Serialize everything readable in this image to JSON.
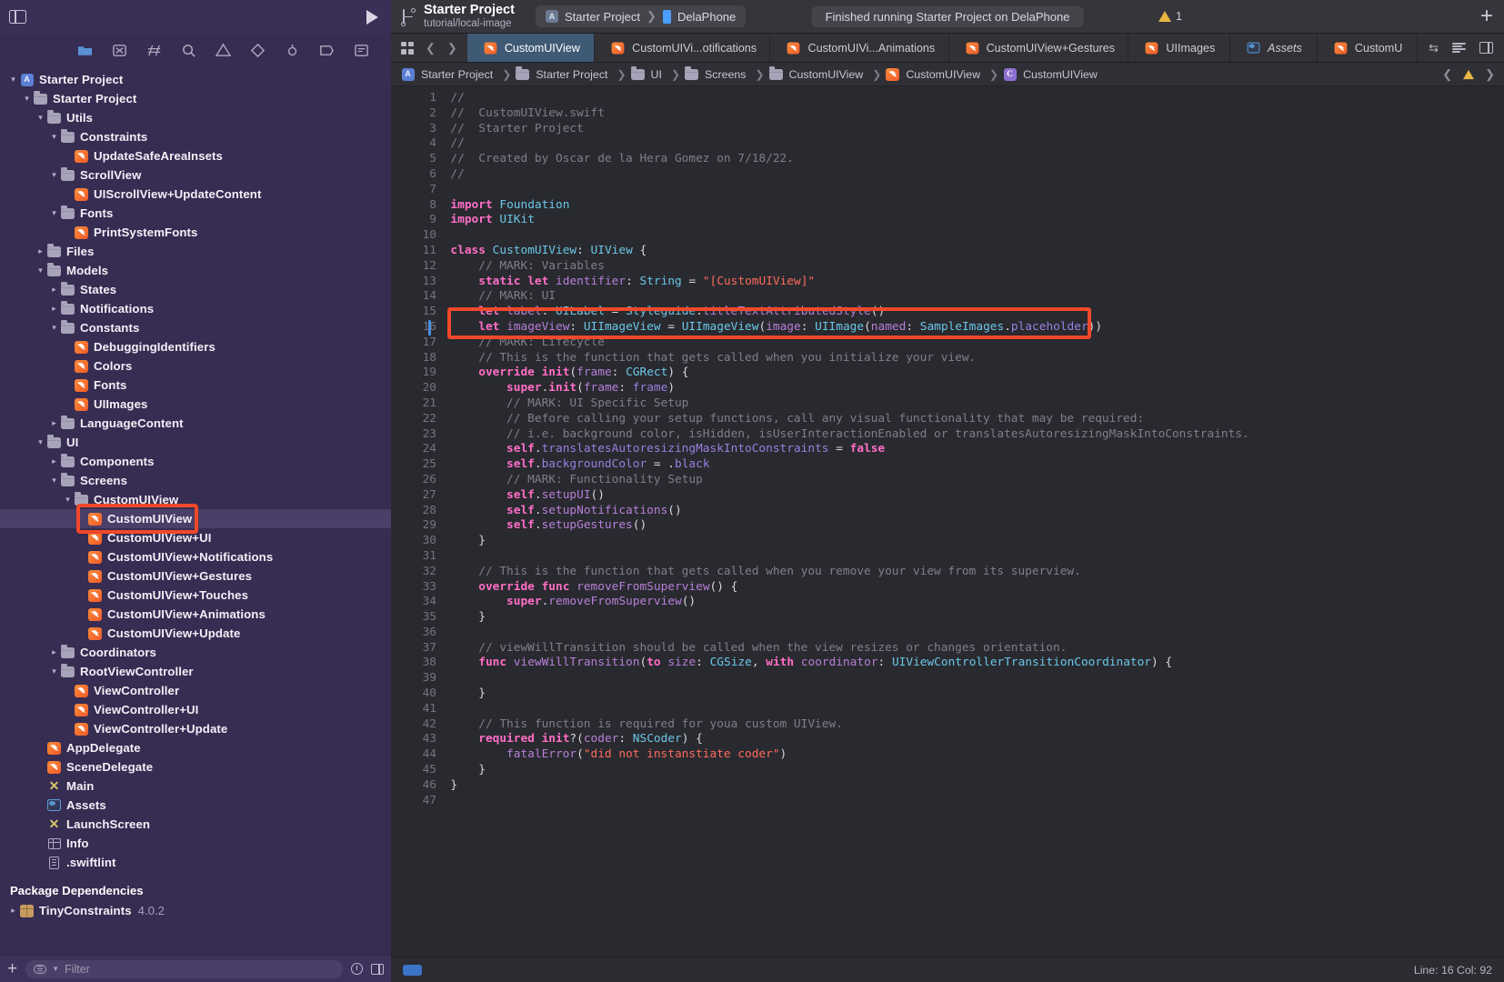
{
  "topbar": {
    "sidebar_toggle_icon": "sidebar-toggle-icon",
    "run_icon": "run-triangle-icon",
    "project_name": "Starter Project",
    "project_branch": "tutorial/local-image",
    "scheme_name": "Starter Project",
    "destination_name": "DelaPhone",
    "status_text": "Finished running Starter Project on DelaPhone",
    "warning_count": "1",
    "add_label": "+"
  },
  "navigator": {
    "toolbar_icons": [
      "folder-icon",
      "source-control-icon",
      "symbol-icon",
      "search-icon",
      "issue-icon",
      "test-icon",
      "debug-icon",
      "breakpoint-icon",
      "report-icon"
    ],
    "tree": [
      {
        "label": "Starter Project",
        "depth": 0,
        "icon": "project-icon",
        "disc": "down"
      },
      {
        "label": "Starter Project",
        "depth": 1,
        "icon": "folder-icon",
        "disc": "down"
      },
      {
        "label": "Utils",
        "depth": 2,
        "icon": "folder-icon",
        "disc": "down"
      },
      {
        "label": "Constraints",
        "depth": 3,
        "icon": "folder-icon",
        "disc": "down"
      },
      {
        "label": "UpdateSafeAreaInsets",
        "depth": 4,
        "icon": "swift-icon",
        "disc": "none"
      },
      {
        "label": "ScrollView",
        "depth": 3,
        "icon": "folder-icon",
        "disc": "down"
      },
      {
        "label": "UIScrollView+UpdateContent",
        "depth": 4,
        "icon": "swift-icon",
        "disc": "none"
      },
      {
        "label": "Fonts",
        "depth": 3,
        "icon": "folder-icon",
        "disc": "down"
      },
      {
        "label": "PrintSystemFonts",
        "depth": 4,
        "icon": "swift-icon",
        "disc": "none"
      },
      {
        "label": "Files",
        "depth": 2,
        "icon": "folder-icon",
        "disc": "right"
      },
      {
        "label": "Models",
        "depth": 2,
        "icon": "folder-icon",
        "disc": "down"
      },
      {
        "label": "States",
        "depth": 3,
        "icon": "folder-icon",
        "disc": "right"
      },
      {
        "label": "Notifications",
        "depth": 3,
        "icon": "folder-icon",
        "disc": "right"
      },
      {
        "label": "Constants",
        "depth": 3,
        "icon": "folder-icon",
        "disc": "down"
      },
      {
        "label": "DebuggingIdentifiers",
        "depth": 4,
        "icon": "swift-icon",
        "disc": "none"
      },
      {
        "label": "Colors",
        "depth": 4,
        "icon": "swift-icon",
        "disc": "none"
      },
      {
        "label": "Fonts",
        "depth": 4,
        "icon": "swift-icon",
        "disc": "none"
      },
      {
        "label": "UIImages",
        "depth": 4,
        "icon": "swift-icon",
        "disc": "none"
      },
      {
        "label": "LanguageContent",
        "depth": 3,
        "icon": "folder-icon",
        "disc": "right"
      },
      {
        "label": "UI",
        "depth": 2,
        "icon": "folder-icon",
        "disc": "down"
      },
      {
        "label": "Components",
        "depth": 3,
        "icon": "folder-icon",
        "disc": "right"
      },
      {
        "label": "Screens",
        "depth": 3,
        "icon": "folder-icon",
        "disc": "down"
      },
      {
        "label": "CustomUIView",
        "depth": 4,
        "icon": "folder-icon",
        "disc": "down"
      },
      {
        "label": "CustomUIView",
        "depth": 5,
        "icon": "swift-icon",
        "disc": "none",
        "selected": true
      },
      {
        "label": "CustomUIView+UI",
        "depth": 5,
        "icon": "swift-icon",
        "disc": "none"
      },
      {
        "label": "CustomUIView+Notifications",
        "depth": 5,
        "icon": "swift-icon",
        "disc": "none"
      },
      {
        "label": "CustomUIView+Gestures",
        "depth": 5,
        "icon": "swift-icon",
        "disc": "none"
      },
      {
        "label": "CustomUIView+Touches",
        "depth": 5,
        "icon": "swift-icon",
        "disc": "none"
      },
      {
        "label": "CustomUIView+Animations",
        "depth": 5,
        "icon": "swift-icon",
        "disc": "none"
      },
      {
        "label": "CustomUIView+Update",
        "depth": 5,
        "icon": "swift-icon",
        "disc": "none"
      },
      {
        "label": "Coordinators",
        "depth": 3,
        "icon": "folder-icon",
        "disc": "right"
      },
      {
        "label": "RootViewController",
        "depth": 3,
        "icon": "folder-icon",
        "disc": "down"
      },
      {
        "label": "ViewController",
        "depth": 4,
        "icon": "swift-icon",
        "disc": "none"
      },
      {
        "label": "ViewController+UI",
        "depth": 4,
        "icon": "swift-icon",
        "disc": "none"
      },
      {
        "label": "ViewController+Update",
        "depth": 4,
        "icon": "swift-icon",
        "disc": "none"
      },
      {
        "label": "AppDelegate",
        "depth": 2,
        "icon": "swift-icon",
        "disc": "none"
      },
      {
        "label": "SceneDelegate",
        "depth": 2,
        "icon": "swift-icon",
        "disc": "none"
      },
      {
        "label": "Main",
        "depth": 2,
        "icon": "xib-icon",
        "disc": "none"
      },
      {
        "label": "Assets",
        "depth": 2,
        "icon": "assets-icon",
        "disc": "none"
      },
      {
        "label": "LaunchScreen",
        "depth": 2,
        "icon": "xib-icon",
        "disc": "none"
      },
      {
        "label": "Info",
        "depth": 2,
        "icon": "plist-icon",
        "disc": "none"
      },
      {
        "label": ".swiftlint",
        "depth": 2,
        "icon": "doc-icon",
        "disc": "none"
      }
    ],
    "package_section_title": "Package Dependencies",
    "package_name": "TinyConstraints",
    "package_version": "4.0.2",
    "filter_placeholder": "Filter",
    "add_label": "+"
  },
  "editor": {
    "tabs": [
      {
        "label": "CustomUIView",
        "icon": "swift-icon",
        "active": true
      },
      {
        "label": "CustomUIVi...otifications",
        "icon": "swift-icon"
      },
      {
        "label": "CustomUIVi...Animations",
        "icon": "swift-icon"
      },
      {
        "label": "CustomUIView+Gestures",
        "icon": "swift-icon"
      },
      {
        "label": "UIImages",
        "icon": "swift-icon"
      },
      {
        "label": "Assets",
        "icon": "assets-icon",
        "italic": true
      },
      {
        "label": "CustomU",
        "icon": "swift-icon"
      }
    ],
    "breadcrumb": [
      {
        "label": "Starter Project",
        "icon": "project-icon"
      },
      {
        "label": "Starter Project",
        "icon": "folder-icon"
      },
      {
        "label": "UI",
        "icon": "folder-icon"
      },
      {
        "label": "Screens",
        "icon": "folder-icon"
      },
      {
        "label": "CustomUIView",
        "icon": "folder-icon"
      },
      {
        "label": "CustomUIView",
        "icon": "swift-icon"
      },
      {
        "label": "CustomUIView",
        "icon": "class-icon"
      }
    ],
    "code_lines": [
      {
        "n": 1,
        "t": "//"
      },
      {
        "n": 2,
        "t": "//  CustomUIView.swift"
      },
      {
        "n": 3,
        "t": "//  Starter Project"
      },
      {
        "n": 4,
        "t": "//"
      },
      {
        "n": 5,
        "t": "//  Created by Oscar de la Hera Gomez on 7/18/22."
      },
      {
        "n": 6,
        "t": "//"
      },
      {
        "n": 7,
        "t": ""
      },
      {
        "n": 8,
        "t": "import Foundation"
      },
      {
        "n": 9,
        "t": "import UIKit"
      },
      {
        "n": 10,
        "t": ""
      },
      {
        "n": 11,
        "t": "class CustomUIView: UIView {"
      },
      {
        "n": 12,
        "t": "    // MARK: Variables"
      },
      {
        "n": 13,
        "t": "    static let identifier: String = \"[CustomUIView]\""
      },
      {
        "n": 14,
        "t": "    // MARK: UI"
      },
      {
        "n": 15,
        "t": "    let label: UILabel = Styleguide.titleTextAttributedStyle()"
      },
      {
        "n": 16,
        "t": "    let imageView: UIImageView = UIImageView(image: UIImage(named: SampleImages.placeholder))"
      },
      {
        "n": 17,
        "t": "    // MARK: Lifecycle"
      },
      {
        "n": 18,
        "t": "    // This is the function that gets called when you initialize your view."
      },
      {
        "n": 19,
        "t": "    override init(frame: CGRect) {"
      },
      {
        "n": 20,
        "t": "        super.init(frame: frame)"
      },
      {
        "n": 21,
        "t": "        // MARK: UI Specific Setup"
      },
      {
        "n": 22,
        "t": "        // Before calling your setup functions, call any visual functionality that may be required:"
      },
      {
        "n": 23,
        "t": "        // i.e. background color, isHidden, isUserInteractionEnabled or translatesAutoresizingMaskIntoConstraints."
      },
      {
        "n": 24,
        "t": "        self.translatesAutoresizingMaskIntoConstraints = false"
      },
      {
        "n": 25,
        "t": "        self.backgroundColor = .black"
      },
      {
        "n": 26,
        "t": "        // MARK: Functionality Setup"
      },
      {
        "n": 27,
        "t": "        self.setupUI()"
      },
      {
        "n": 28,
        "t": "        self.setupNotifications()"
      },
      {
        "n": 29,
        "t": "        self.setupGestures()"
      },
      {
        "n": 30,
        "t": "    }"
      },
      {
        "n": 31,
        "t": ""
      },
      {
        "n": 32,
        "t": "    // This is the function that gets called when you remove your view from its superview."
      },
      {
        "n": 33,
        "t": "    override func removeFromSuperview() {"
      },
      {
        "n": 34,
        "t": "        super.removeFromSuperview()"
      },
      {
        "n": 35,
        "t": "    }"
      },
      {
        "n": 36,
        "t": ""
      },
      {
        "n": 37,
        "t": "    // viewWillTransition should be called when the view resizes or changes orientation."
      },
      {
        "n": 38,
        "t": "    func viewWillTransition(to size: CGSize, with coordinator: UIViewControllerTransitionCoordinator) {"
      },
      {
        "n": 39,
        "t": ""
      },
      {
        "n": 40,
        "t": "    }"
      },
      {
        "n": 41,
        "t": ""
      },
      {
        "n": 42,
        "t": "    // This function is required for youa custom UIView."
      },
      {
        "n": 43,
        "t": "    required init?(coder: NSCoder) {"
      },
      {
        "n": 44,
        "t": "        fatalError(\"did not instanstiate coder\")"
      },
      {
        "n": 45,
        "t": "    }"
      },
      {
        "n": 46,
        "t": "}"
      },
      {
        "n": 47,
        "t": ""
      }
    ],
    "cursor_line": 16
  },
  "statusbar": {
    "line_col": "Line: 16  Col: 92"
  },
  "colors": {
    "navigator_bg": "#372c52",
    "selection_bg": "#4a3f68",
    "annotation_red": "#f0482a",
    "tab_active_bg": "#3f5a75",
    "editor_bg": "#292a2f",
    "swift_orange": "#f05a28",
    "warning_yellow": "#e8b642"
  }
}
